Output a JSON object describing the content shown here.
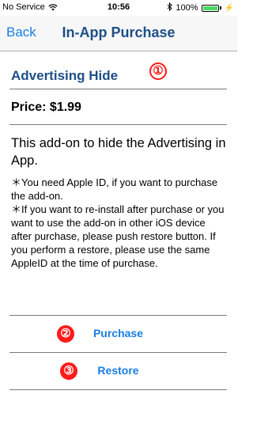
{
  "status_bar": {
    "carrier": "No Service",
    "time": "10:56",
    "battery": "100%",
    "icons": [
      "wifi-icon",
      "bluetooth-icon",
      "battery-icon",
      "charging-icon"
    ]
  },
  "nav": {
    "back_label": "Back",
    "title": "In-App Purchase"
  },
  "product": {
    "title": "Advertising Hide",
    "marker": "①",
    "price_label": "Price: $1.99",
    "description": "This add-on to hide the Advertising in App.",
    "notes": [
      "＊You need Apple ID, if you want to purchase the add-on.",
      "＊If you want to re-install after purchase or you want to use the add-on in other iOS device  after purchase, please push restore button. If you perform a restore, please use the same AppleID at the time of purchase."
    ]
  },
  "actions": {
    "purchase_label": "Purchase",
    "purchase_marker": "②",
    "restore_label": "Restore",
    "restore_marker": "③"
  },
  "colors": {
    "accent": "#1a7ee6",
    "title_blue": "#1e4f87",
    "marker_red": "#ff1a1a"
  }
}
